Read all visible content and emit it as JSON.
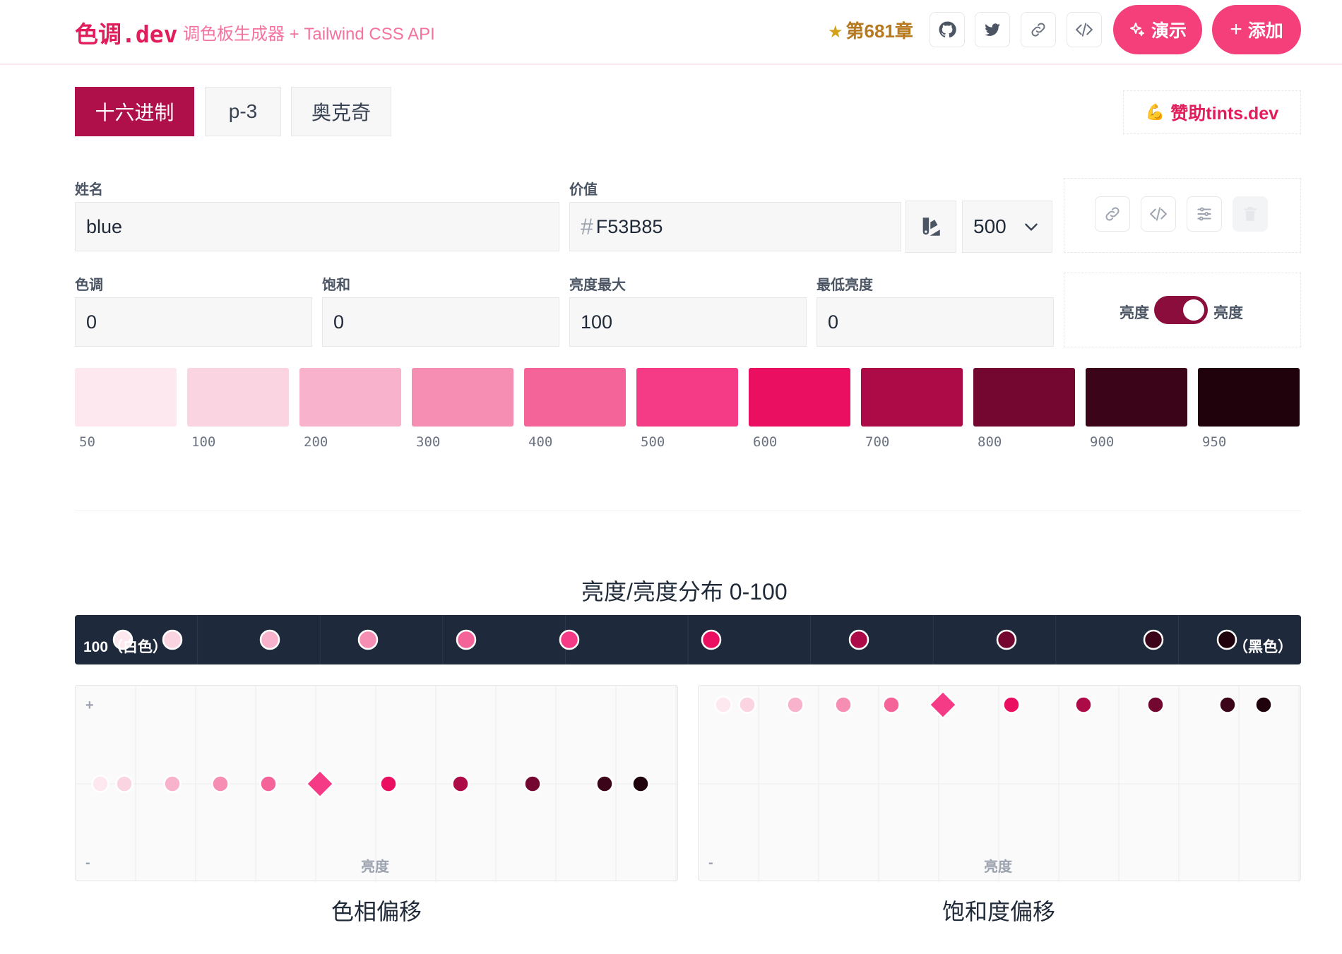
{
  "header": {
    "brand": "色调.dev",
    "tagline": "调色板生成器 + Tailwind CSS API",
    "badge": "第681章",
    "demo_label": "演示",
    "add_label": "添加"
  },
  "tabs": [
    "十六进制",
    "p-3",
    "奥克奇"
  ],
  "sponsor_label": "赞助tints.dev",
  "form": {
    "name_label": "姓名",
    "name_value": "blue",
    "value_label": "价值",
    "value_hash": "#",
    "value_value": "F53B85",
    "shade_value": "500",
    "hue_label": "色调",
    "hue_value": "0",
    "saturation_label": "饱和",
    "saturation_value": "0",
    "lum_max_label": "亮度最大",
    "lum_max_value": "100",
    "lum_min_label": "最低亮度",
    "lum_min_value": "0",
    "toggle_left": "亮度",
    "toggle_right": "亮度"
  },
  "palette": [
    {
      "label": "50",
      "color": "#FDE8EF"
    },
    {
      "label": "100",
      "color": "#FBD4E2"
    },
    {
      "label": "200",
      "color": "#F8B2CC"
    },
    {
      "label": "300",
      "color": "#F58EB2"
    },
    {
      "label": "400",
      "color": "#F46498"
    },
    {
      "label": "500",
      "color": "#F53B85"
    },
    {
      "label": "600",
      "color": "#EB0F62"
    },
    {
      "label": "700",
      "color": "#AD0B47"
    },
    {
      "label": "800",
      "color": "#74072F"
    },
    {
      "label": "900",
      "color": "#3C0418"
    },
    {
      "label": "950",
      "color": "#1F020C"
    }
  ],
  "distribution": {
    "title": "亮度/亮度分布 0-100",
    "left_label": "100（白色）",
    "right_label": "（黑色）"
  },
  "hue_panel": {
    "title": "色相偏移",
    "plus": "+",
    "minus": "-",
    "x_axis": "亮度"
  },
  "sat_panel": {
    "title": "饱和度偏移",
    "minus": "-",
    "x_axis": "亮度"
  }
}
